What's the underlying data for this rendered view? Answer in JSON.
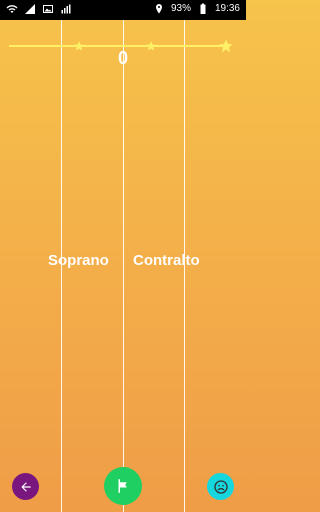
{
  "status_bar": {
    "battery": "93%",
    "time": "19:36"
  },
  "game": {
    "score": "0",
    "progress_fraction": 0.0,
    "stars": 3,
    "lanes": [
      {
        "label": "Soprano"
      },
      {
        "label": "Contralto"
      }
    ]
  },
  "icons": {
    "back": "arrow-left-icon",
    "flag": "flag-icon",
    "face": "sad-face-icon"
  },
  "colors": {
    "back_button": "#7a177f",
    "flag_button": "#1fcf62",
    "face_button": "#17d7de",
    "star": "#fff066"
  }
}
